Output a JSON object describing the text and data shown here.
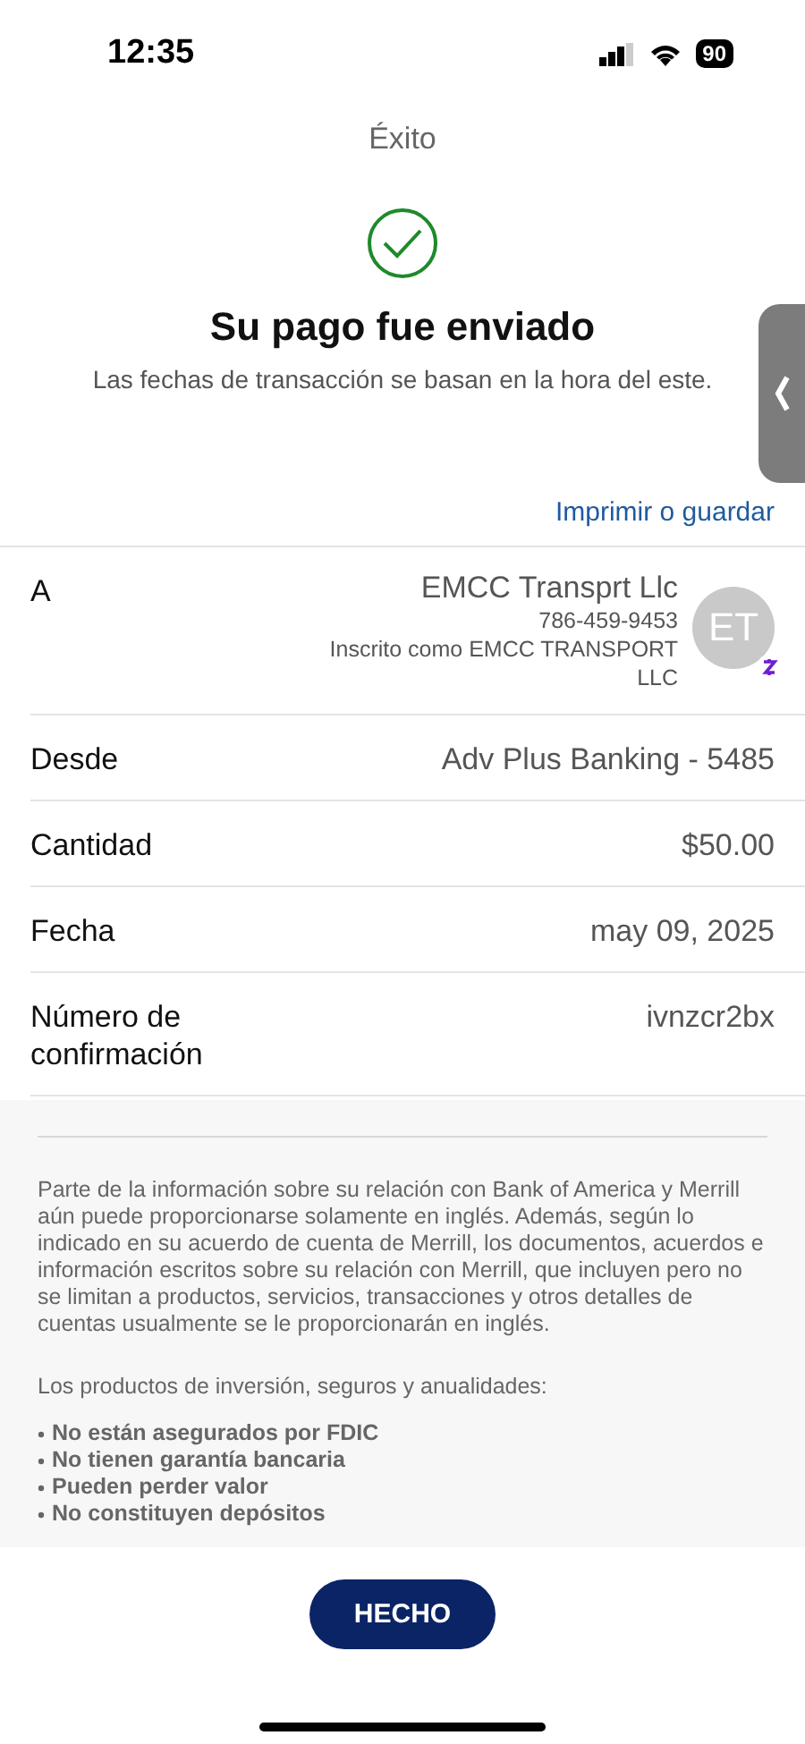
{
  "status_bar": {
    "time": "12:35",
    "battery": "90"
  },
  "header": {
    "title": "Éxito"
  },
  "confirmation": {
    "heading": "Su pago fue enviado",
    "note": "Las fechas de transacción se basan en la hora del este."
  },
  "print_link": "Imprimir o guardar",
  "recipient": {
    "label": "A",
    "name": "EMCC Transprt Llc",
    "phone": "786-459-9453",
    "enrolled": "Inscrito como EMCC TRANSPORT LLC",
    "initials": "ET"
  },
  "details": [
    {
      "label": "Desde",
      "value": "Adv Plus Banking - 5485"
    },
    {
      "label": "Cantidad",
      "value": "$50.00"
    },
    {
      "label": "Fecha",
      "value": "may 09, 2025"
    },
    {
      "label": "Número de confirmación",
      "value": "ivnzcr2bx"
    }
  ],
  "disclosure": {
    "paragraph": "Parte de la información sobre su relación con Bank of America y Merrill aún puede proporcionarse solamente en inglés. Además, según lo indicado en su acuerdo de cuenta de Merrill, los documentos, acuerdos e información escritos sobre su relación con Merrill, que incluyen pero no se limitan a productos, servicios, transacciones y otros detalles de cuentas usualmente se le proporcionarán en inglés.",
    "list_heading": "Los productos de inversión, seguros y anualidades:",
    "bullets": [
      "No están asegurados por FDIC",
      "No tienen garantía bancaria",
      "Pueden perder valor",
      "No constituyen depósitos"
    ]
  },
  "done_button": "HECHO"
}
